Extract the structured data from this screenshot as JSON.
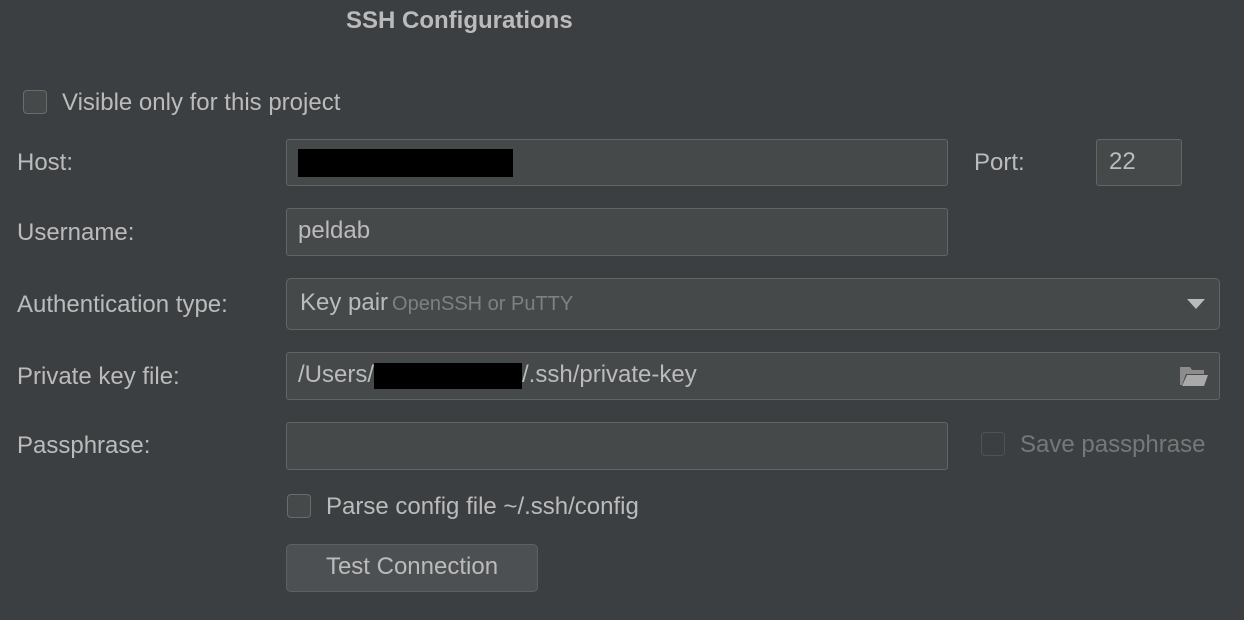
{
  "dialog": {
    "title": "SSH Configurations"
  },
  "visibility": {
    "label": "Visible only for this project",
    "checked": false
  },
  "host": {
    "label": "Host:",
    "value_redacted": true
  },
  "port": {
    "label": "Port:",
    "value": "22"
  },
  "username": {
    "label": "Username:",
    "value": "peldab"
  },
  "auth": {
    "label": "Authentication type:",
    "selected": "Key pair",
    "hint": "OpenSSH or PuTTY",
    "icon": "chevron-down-icon"
  },
  "private_key": {
    "label": "Private key file:",
    "prefix": "/Users/",
    "suffix": "/.ssh/private-key",
    "icon": "folder-open-icon"
  },
  "passphrase": {
    "label": "Passphrase:",
    "value": "",
    "save_label": "Save passphrase",
    "save_checked": false,
    "save_enabled": false
  },
  "parse_config": {
    "label": "Parse config file ~/.ssh/config",
    "checked": false
  },
  "actions": {
    "test_label": "Test Connection"
  },
  "colors": {
    "background": "#3c3f41",
    "field_background": "#45494a",
    "text": "#bbbbbb",
    "redaction": "#000000"
  }
}
